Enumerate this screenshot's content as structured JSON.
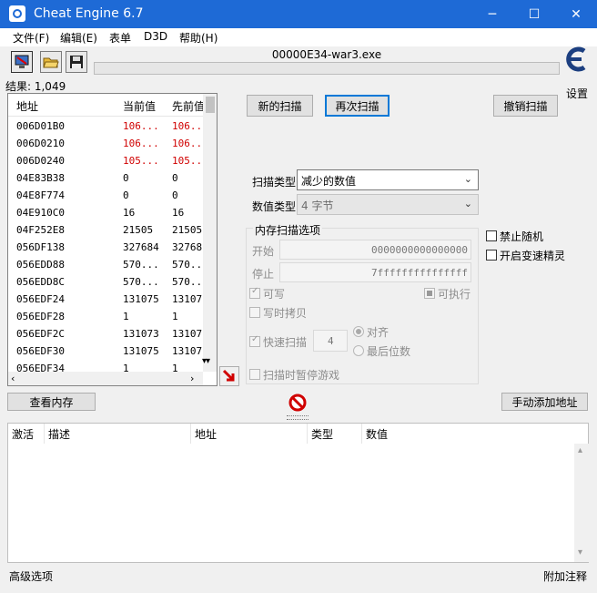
{
  "window": {
    "title": "Cheat Engine 6.7",
    "minimize": "─",
    "maximize": "☐",
    "close": "✕"
  },
  "menu": [
    "文件(F)",
    "编辑(E)",
    "表单",
    "D3D",
    "帮助(H)"
  ],
  "toolbar": {
    "process_name": "00000E34-war3.exe",
    "settings_label": "设置"
  },
  "results_label": "结果: 1,049",
  "scan_list": {
    "columns": [
      "地址",
      "当前值",
      "先前值"
    ],
    "rows": [
      {
        "addr": "006D01B0",
        "cur": "106...",
        "prev": "106...",
        "changed": true
      },
      {
        "addr": "006D0210",
        "cur": "106...",
        "prev": "106...",
        "changed": true
      },
      {
        "addr": "006D0240",
        "cur": "105...",
        "prev": "105...",
        "changed": true
      },
      {
        "addr": "04E83B38",
        "cur": "0",
        "prev": "0",
        "changed": false
      },
      {
        "addr": "04E8F774",
        "cur": "0",
        "prev": "0",
        "changed": false
      },
      {
        "addr": "04E910C0",
        "cur": "16",
        "prev": "16",
        "changed": false
      },
      {
        "addr": "04F252E8",
        "cur": "21505",
        "prev": "21505",
        "changed": false
      },
      {
        "addr": "056DF138",
        "cur": "327684",
        "prev": "32768",
        "changed": false
      },
      {
        "addr": "056EDD88",
        "cur": "570...",
        "prev": "570...",
        "changed": false
      },
      {
        "addr": "056EDD8C",
        "cur": "570...",
        "prev": "570...",
        "changed": false
      },
      {
        "addr": "056EDF24",
        "cur": "131075",
        "prev": "13107",
        "changed": false
      },
      {
        "addr": "056EDF28",
        "cur": "1",
        "prev": "1",
        "changed": false
      },
      {
        "addr": "056EDF2C",
        "cur": "131073",
        "prev": "13107",
        "changed": false
      },
      {
        "addr": "056EDF30",
        "cur": "131075",
        "prev": "13107",
        "changed": false
      },
      {
        "addr": "056EDF34",
        "cur": "1",
        "prev": "1",
        "changed": false
      }
    ]
  },
  "buttons": {
    "new_scan": "新的扫描",
    "next_scan": "再次扫描",
    "undo_scan": "撤销扫描",
    "view_memory": "查看内存",
    "add_address": "手动添加地址"
  },
  "scan_options": {
    "scan_type_label": "扫描类型",
    "scan_type_value": "减少的数值",
    "value_type_label": "数值类型",
    "value_type_value": "4 字节",
    "memory_group_label": "内存扫描选项",
    "start_label": "开始",
    "start_value": "0000000000000000",
    "stop_label": "停止",
    "stop_value": "7fffffffffffffff",
    "writable": "可写",
    "executable": "可执行",
    "copy_on_write": "写时拷贝",
    "fast_scan": "快速扫描",
    "fast_scan_value": "4",
    "align": "对齐",
    "last_digits": "最后位数",
    "pause_game": "扫描时暂停游戏",
    "disable_random": "禁止随机",
    "speedhack": "开启变速精灵"
  },
  "address_table": {
    "columns": [
      "激活",
      "描述",
      "地址",
      "类型",
      "数值"
    ]
  },
  "footer": {
    "advanced": "高级选项",
    "comment": "附加注释"
  },
  "icons": {
    "app": "cheat-engine-icon",
    "open_process": "computer-icon",
    "open_file": "folder-open-icon",
    "save": "floppy-icon",
    "stop": "no-entry-icon",
    "pointer": "arrow-down-right-icon"
  },
  "colors": {
    "titlebar": "#1e6ad6",
    "changed_value": "#d00000",
    "focus": "#0078d7"
  }
}
